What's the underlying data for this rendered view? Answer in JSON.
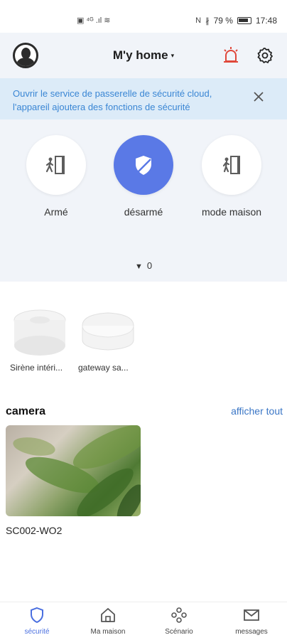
{
  "statusbar": {
    "left_icons": "▣ ⁴ᴳ .ıl ≋",
    "nfc": "N",
    "bt": "∦",
    "battery": "79 %",
    "time": "17:48"
  },
  "header": {
    "title": "M'y home",
    "caret": "▾"
  },
  "banner": {
    "text": "Ouvrir le service de passerelle de sécurité cloud, l'appareil ajoutera des fonctions de sécurité"
  },
  "modes": [
    {
      "label": "Armé"
    },
    {
      "label": "désarmé"
    },
    {
      "label": "mode maison"
    }
  ],
  "alert_count": {
    "arrow": "▼",
    "value": "0"
  },
  "devices": [
    {
      "name": "Sirène intéri..."
    },
    {
      "name": "gateway sa..."
    }
  ],
  "camera_section": {
    "title": "camera",
    "see_all": "afficher tout",
    "camera_name": "SC002-WO2"
  },
  "tabbar": [
    {
      "label": "sécurité"
    },
    {
      "label": "Ma maison"
    },
    {
      "label": "Scénario"
    },
    {
      "label": "messages"
    }
  ],
  "colors": {
    "accent": "#5a79e6",
    "banner_bg": "#dcebf8",
    "banner_text": "#3a86d4",
    "alarm_red": "#e0473a",
    "link": "#3a76c6"
  }
}
